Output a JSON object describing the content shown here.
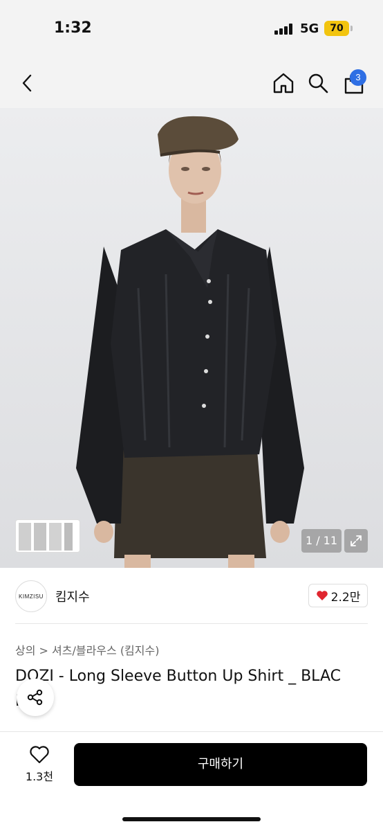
{
  "status_bar": {
    "time": "1:32",
    "network": "5G",
    "battery": "70"
  },
  "nav": {
    "cart_count": "3"
  },
  "gallery": {
    "counter": "1 / 11"
  },
  "shop": {
    "logo_text": "KIMZISU",
    "name": "킴지수",
    "likes": "2.2만"
  },
  "product": {
    "breadcrumb": "상의 > 셔츠/블라우스 (킴지수)",
    "title": "DOZI - Long Sleeve Button Up Shirt _ BLAC",
    "title_line2": "K"
  },
  "bottom_bar": {
    "wish_count": "1.3천",
    "buy_label": "구매하기"
  },
  "colors": {
    "accent_badge": "#2f6fe4",
    "battery": "#f2c40f",
    "heart": "#e0262f",
    "buy_button": "#000000"
  }
}
